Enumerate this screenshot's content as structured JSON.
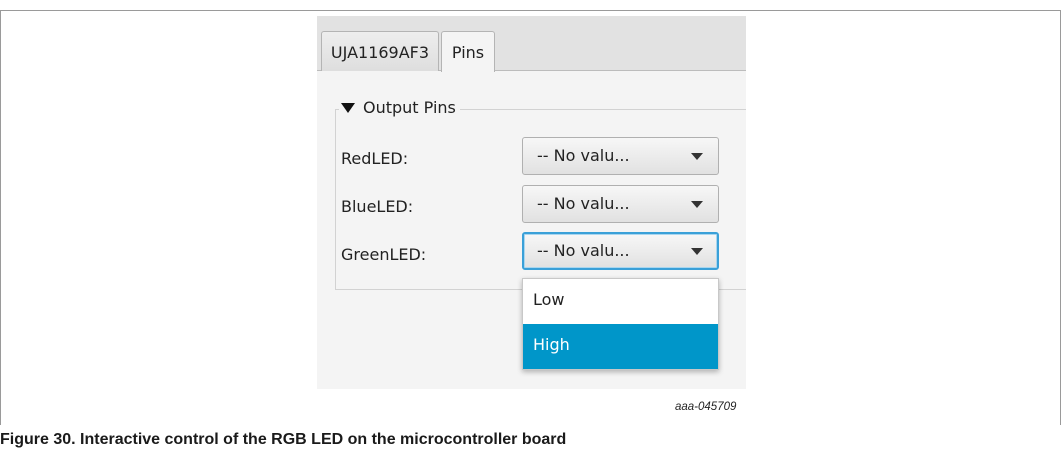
{
  "tabs": [
    {
      "label": "UJA1169AF3",
      "selected": false
    },
    {
      "label": "Pins",
      "selected": true
    }
  ],
  "group": {
    "title": "Output Pins",
    "icon": "triangle-down-icon"
  },
  "pins": [
    {
      "label": "RedLED:",
      "value": "-- No valu...",
      "focused": false
    },
    {
      "label": "BlueLED:",
      "value": "-- No valu...",
      "focused": false
    },
    {
      "label": "GreenLED:",
      "value": "-- No valu...",
      "focused": true
    }
  ],
  "dropdown": {
    "options": [
      "Low",
      "High"
    ],
    "highlighted": "High",
    "highlight_color": "#0096c9"
  },
  "figure_id": "aaa-045709",
  "caption": "Figure 30.  Interactive control of the RGB LED on the microcontroller board"
}
